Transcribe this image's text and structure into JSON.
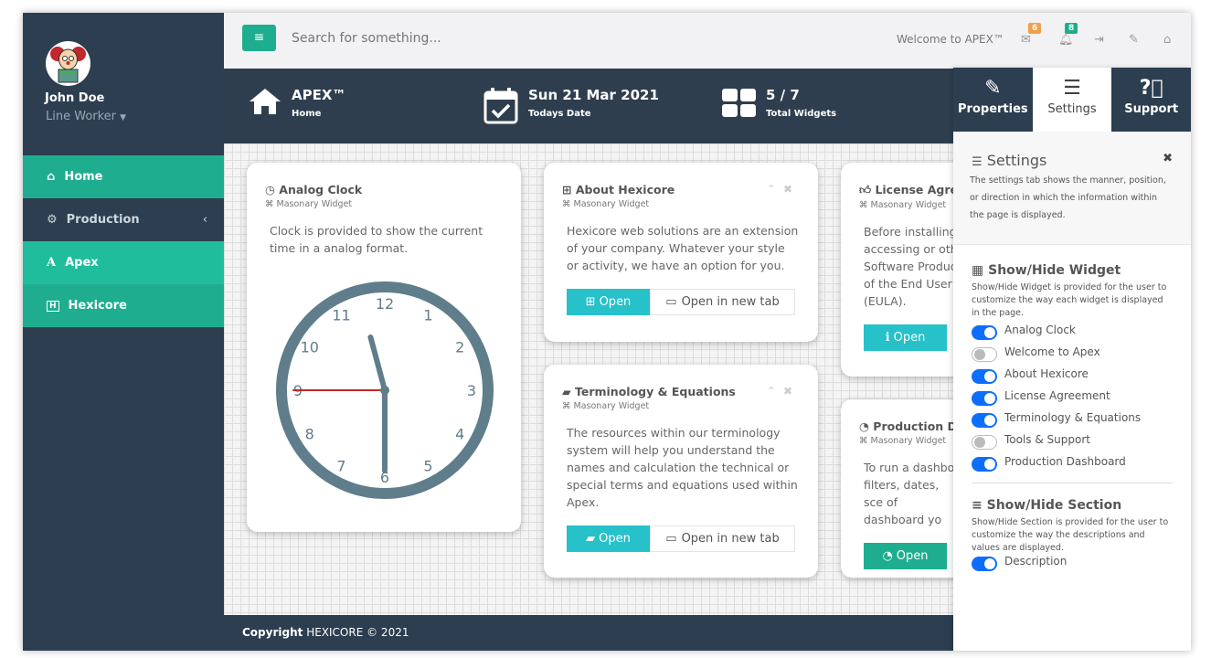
{
  "sidebar": {
    "user_name": "John Doe",
    "user_role": "Line Worker",
    "items": [
      {
        "label": "Home",
        "icon": "home-icon",
        "color": "#1eae8f"
      },
      {
        "label": "Production",
        "icon": "gear-icon",
        "color": "#2c3e50"
      },
      {
        "label": "Apex",
        "icon": "apex-a-icon",
        "color": "#1fbd9c"
      },
      {
        "label": "Hexicore",
        "icon": "hexicore-h-icon",
        "color": "#1eae8f"
      }
    ]
  },
  "topbar": {
    "search_placeholder": "Search for something...",
    "welcome": "Welcome to APEX™",
    "mail_count": "6",
    "bell_count": "8",
    "mail_badge_color": "#f0a04b",
    "bell_badge_color": "#1eae8f"
  },
  "header": {
    "app": {
      "title": "APEX™",
      "sub": "Home"
    },
    "date": {
      "title": "Sun 21 Mar 2021",
      "sub": "Todays Date"
    },
    "widgets": {
      "title": "5 / 7",
      "sub": "Total Widgets"
    }
  },
  "widgets": [
    {
      "title": "Analog Clock",
      "sub": "Masonary Widget",
      "body": "Clock is provided to show the current time in a analog format.",
      "clock": {
        "numbers": [
          "12",
          "1",
          "2",
          "3",
          "4",
          "5",
          "6",
          "7",
          "8",
          "9",
          "10",
          "11"
        ],
        "hour": 11.5,
        "minute": 30,
        "second": 45
      }
    },
    {
      "title": "About Hexicore",
      "sub": "Masonary Widget",
      "body": "Hexicore web solutions are an extension of your company. Whatever your style or activity, we have an option for you.",
      "open": "Open",
      "open_new": "Open in new tab"
    },
    {
      "title": "Terminology & Equations",
      "sub": "Masonary Widget",
      "body": "The resources within our terminology system will help you understand the names and calculation the technical or special terms and equations used within Apex.",
      "open": "Open",
      "open_new": "Open in new tab"
    },
    {
      "title": "License Agree",
      "sub": "Masonary Widget",
      "body": "Before installing accessing or oth Software Produc of the End User (EULA).",
      "open": "Open"
    },
    {
      "title": "Production D",
      "sub": "Masonary Widget",
      "body": "To run a dashbo filters, dates, sce of dashboard yo",
      "open": "Open"
    }
  ],
  "footer": {
    "bold": "Copyright",
    "text": " HEXICORE © 2021"
  },
  "panel": {
    "tabs": [
      "Properties",
      "Settings",
      "Support"
    ],
    "title": "Settings",
    "desc": "The settings tab shows the manner, position, or direction in which the information within the page is displayed.",
    "widget_section": {
      "title": "Show/Hide Widget",
      "desc": "Show/Hide Widget is provided for the user to customize the way each widget is displayed in the page.",
      "toggles": [
        {
          "label": "Analog Clock",
          "on": true
        },
        {
          "label": "Welcome to Apex",
          "on": false
        },
        {
          "label": "About Hexicore",
          "on": true
        },
        {
          "label": "License Agreement",
          "on": true
        },
        {
          "label": "Terminology & Equations",
          "on": true
        },
        {
          "label": "Tools & Support",
          "on": false
        },
        {
          "label": "Production Dashboard",
          "on": true
        }
      ]
    },
    "section_section": {
      "title": "Show/Hide Section",
      "desc": "Show/Hide Section is provided for the user to customize the way the descriptions and values are displayed.",
      "toggles": [
        {
          "label": "Description",
          "on": true
        }
      ]
    }
  }
}
